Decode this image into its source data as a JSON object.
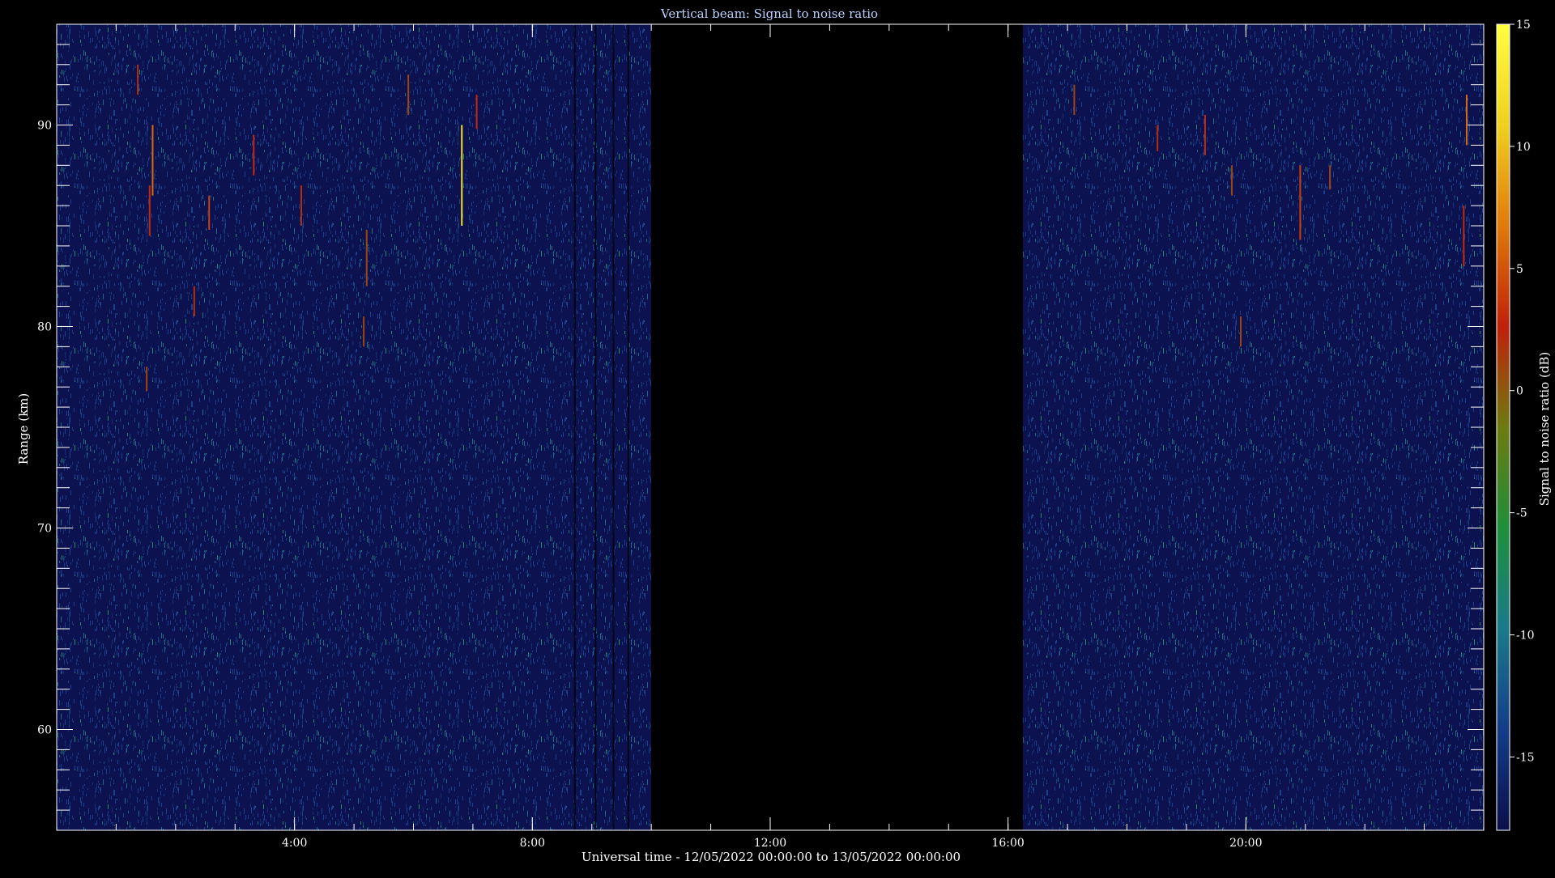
{
  "chart_data": {
    "type": "heatmap",
    "title": "Vertical beam: Signal to noise ratio",
    "xlabel": "Universal time - 12/05/2022 00:00:00 to 13/05/2022 00:00:00",
    "ylabel": "Range (km)",
    "x_unit": "hours UT",
    "xlim": [
      0,
      24
    ],
    "ylim": [
      55,
      95
    ],
    "x_ticks": [
      4,
      8,
      12,
      16,
      20
    ],
    "x_tick_labels": [
      "4:00",
      "8:00",
      "12:00",
      "16:00",
      "20:00"
    ],
    "y_ticks": [
      60,
      70,
      80,
      90
    ],
    "y_tick_labels": [
      "60",
      "70",
      "80",
      "90"
    ],
    "colorbar": {
      "label": "Signal to noise ratio (dB)",
      "range": [
        -18,
        15
      ],
      "ticks": [
        -15,
        -10,
        -5,
        0,
        5,
        10,
        15
      ],
      "tick_labels": [
        "-15",
        "-10",
        "-5",
        "0",
        "5",
        "10",
        "15"
      ],
      "colormap": [
        "#0b0f4a",
        "#143d8a",
        "#1a7a8a",
        "#1e8f3a",
        "#6e7a12",
        "#c0200a",
        "#e07a0a",
        "#f0d020",
        "#ffff40"
      ]
    },
    "no_data_gap": {
      "from": 10,
      "to": 16.25
    },
    "background_snr": -15,
    "features": [
      {
        "time": 1.35,
        "range_top": 93,
        "range_bottom": 91.5,
        "snr": 2
      },
      {
        "time": 1.6,
        "range_top": 90,
        "range_bottom": 86.5,
        "snr": 6
      },
      {
        "time": 1.55,
        "range_top": 87,
        "range_bottom": 84.5,
        "snr": 3
      },
      {
        "time": 2.55,
        "range_top": 86.5,
        "range_bottom": 84.8,
        "snr": 4
      },
      {
        "time": 3.3,
        "range_top": 89.5,
        "range_bottom": 87.5,
        "snr": 3
      },
      {
        "time": 4.1,
        "range_top": 87,
        "range_bottom": 85,
        "snr": 2
      },
      {
        "time": 5.2,
        "range_top": 84.8,
        "range_bottom": 82,
        "snr": 1
      },
      {
        "time": 5.9,
        "range_top": 92.5,
        "range_bottom": 90.5,
        "snr": 1
      },
      {
        "time": 6.8,
        "range_top": 90,
        "range_bottom": 85,
        "snr": 12
      },
      {
        "time": 7.05,
        "range_top": 91.5,
        "range_bottom": 89.8,
        "snr": 3
      },
      {
        "time": 2.3,
        "range_top": 82,
        "range_bottom": 80.5,
        "snr": 2
      },
      {
        "time": 5.15,
        "range_top": 80.5,
        "range_bottom": 79,
        "snr": 1
      },
      {
        "time": 1.5,
        "range_top": 78,
        "range_bottom": 76.8,
        "snr": 1
      },
      {
        "time": 17.1,
        "range_top": 92,
        "range_bottom": 90.5,
        "snr": 1
      },
      {
        "time": 18.5,
        "range_top": 90,
        "range_bottom": 88.7,
        "snr": 2
      },
      {
        "time": 19.3,
        "range_top": 90.5,
        "range_bottom": 88.5,
        "snr": 3
      },
      {
        "time": 20.9,
        "range_top": 88,
        "range_bottom": 84.3,
        "snr": 4
      },
      {
        "time": 21.4,
        "range_top": 88,
        "range_bottom": 86.8,
        "snr": 1
      },
      {
        "time": 23.7,
        "range_top": 91.5,
        "range_bottom": 89,
        "snr": 6
      },
      {
        "time": 23.65,
        "range_top": 86,
        "range_bottom": 83,
        "snr": 3
      },
      {
        "time": 19.75,
        "range_top": 88,
        "range_bottom": 86.5,
        "snr": 1
      },
      {
        "time": 19.9,
        "range_top": 80.5,
        "range_bottom": 79,
        "snr": 1
      }
    ]
  }
}
